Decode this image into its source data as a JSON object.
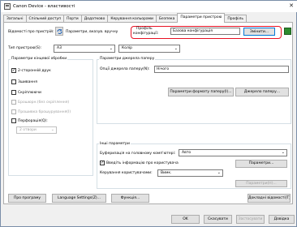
{
  "window": {
    "title": "Canon Device - властивості",
    "close_glyph": "✕"
  },
  "tabs": [
    "Загальні",
    "Спільний доступ",
    "Порти",
    "Додатково",
    "Керування кольорами",
    "Безпека",
    "Параметри пристрою",
    "Профіль"
  ],
  "active_tab": "Параметри пристрою",
  "device_info": {
    "label": "Відомості про пристрій:",
    "value": "Параметри, вказув. вручну"
  },
  "profile": {
    "label_line1": "Профіль",
    "label_line2": "конфігурації:",
    "value": "Базова конфігурація",
    "change_button": "Змінити..."
  },
  "printer_type": {
    "label": "Тип пристрою(S):",
    "value": "A3"
  },
  "color": {
    "value": "Колір"
  },
  "finishing": {
    "title": "Параметри кінцевої обробки",
    "items": [
      {
        "label": "2-сторонній друк",
        "checked": true,
        "enabled": true
      },
      {
        "label": "Зшивання",
        "checked": false,
        "enabled": true
      },
      {
        "label": "Скріплюючи",
        "checked": false,
        "enabled": true
      },
      {
        "label": "Брошюрн.(без скріплення)",
        "checked": false,
        "enabled": false
      },
      {
        "label": "Прошивка брошурування(I)",
        "checked": false,
        "enabled": false
      },
      {
        "label": "Перфорація(Q):",
        "checked": false,
        "enabled": true
      }
    ],
    "holes_value": "2 отвори"
  },
  "paper_source": {
    "title": "Параметри джерела паперу",
    "option_label": "Опції джерела паперу(N):",
    "option_value": "Нічого",
    "paper_format_button": "Параметри формату паперу(I)...",
    "paper_source_button": "Джерело паперу..."
  },
  "other": {
    "title": "Інші параметри",
    "spool_label": "Буферизація на головному комп'ютері:",
    "spool_value": "Авто",
    "user_info_label": "Введіть інформацію про користувача",
    "user_info_checked": true,
    "params_button": "Параметри...",
    "user_mgmt_label": "Керування користувачами:",
    "user_mgmt_value": "Вимк.",
    "params_button_disabled": "Параметри(H)..."
  },
  "bottom_buttons": {
    "about": "Про програму",
    "language": "Language Settings(Z)...",
    "functions": "Функція...",
    "details": "Докладні відомості(T)..."
  },
  "footer": {
    "ok": "OK",
    "cancel": "Скасувати",
    "apply": "Застосувати",
    "help": "Довідка"
  }
}
